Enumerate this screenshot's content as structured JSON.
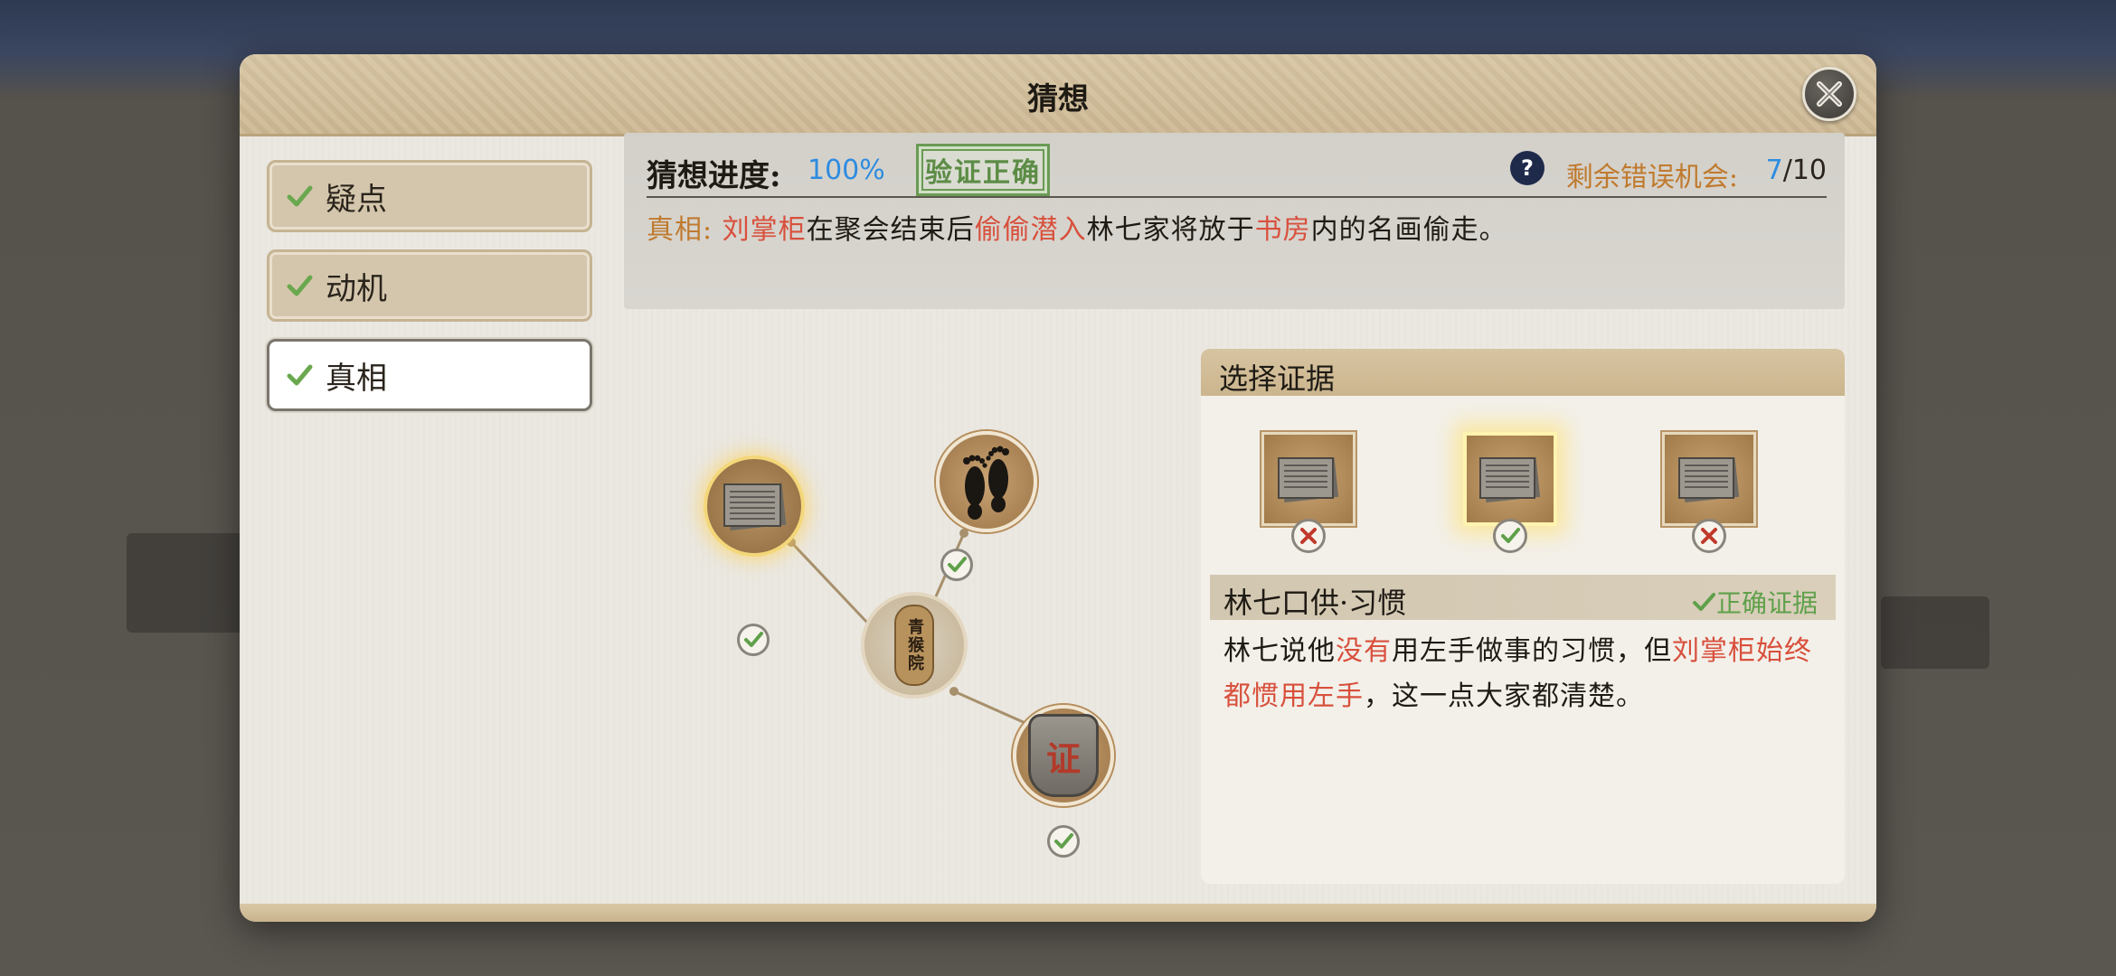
{
  "dialog": {
    "title": "猜想"
  },
  "tabs": [
    {
      "label": "疑点",
      "checked": true,
      "active": false
    },
    {
      "label": "动机",
      "checked": true,
      "active": false
    },
    {
      "label": "真相",
      "checked": true,
      "active": true
    }
  ],
  "progress": {
    "label": "猜想进度:",
    "value": "100%",
    "stamp_text": "验证正确"
  },
  "chances": {
    "label": "剩余错误机会:",
    "current": "7",
    "total": "/10"
  },
  "truth": {
    "prefix": "真相:",
    "suspect": "刘掌柜",
    "part1": "在聚会结束后",
    "action": "偷偷潜入",
    "part2": "林七家将放于",
    "place": "书房",
    "part3": "内的名画偷走。"
  },
  "graph": {
    "center_seal_text": "青猴院",
    "certificate_text": "证",
    "nodes": [
      {
        "name": "document",
        "verified": true
      },
      {
        "name": "footprints",
        "verified": true
      },
      {
        "name": "certificate",
        "verified": true
      }
    ]
  },
  "evidence": {
    "title": "选择证据",
    "cards": [
      {
        "result": "wrong"
      },
      {
        "result": "correct",
        "selected": true
      },
      {
        "result": "wrong"
      }
    ],
    "detail_title": "林七口供·习惯",
    "detail_tag": "正确证据",
    "body": {
      "t1": "林七说他",
      "r1": "没有",
      "t2": "用左手做事的习惯，但",
      "r2": "刘掌柜始终都惯用左手",
      "t3": "，这一点大家都清楚。"
    }
  },
  "colors": {
    "accent_blue": "#2e8ce0",
    "highlight_red": "#d8503c",
    "label_orange": "#c07a2e",
    "success_green": "#5fa04a"
  }
}
